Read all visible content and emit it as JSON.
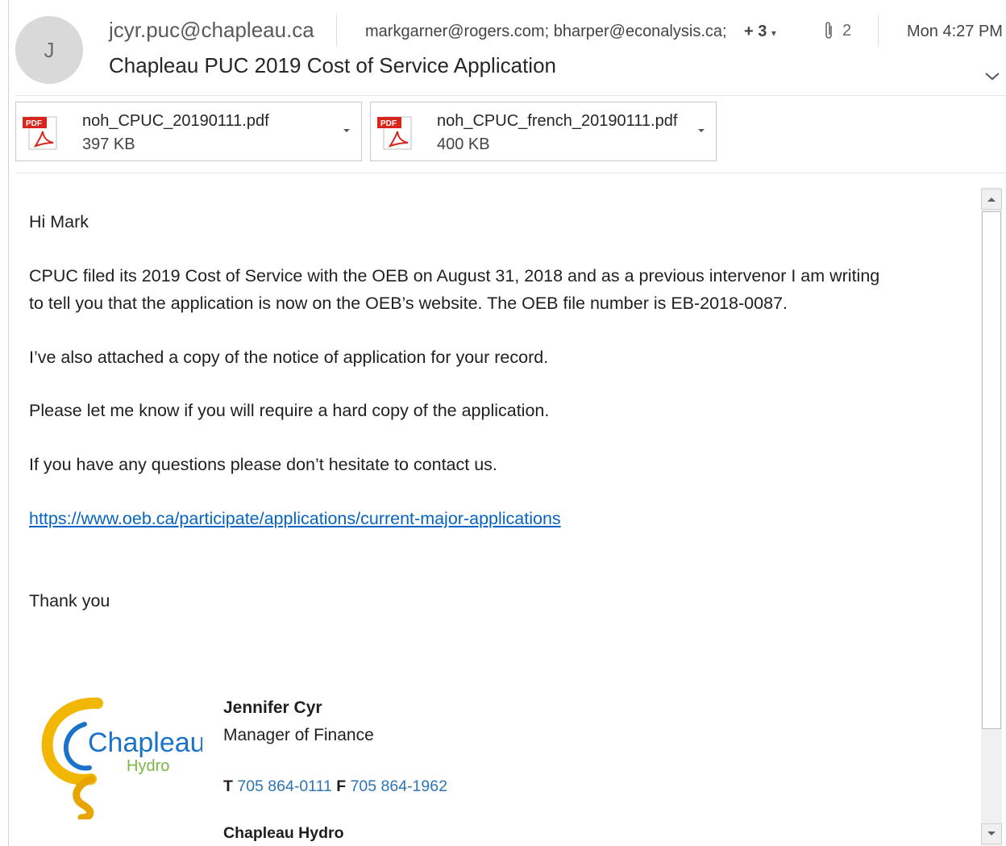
{
  "header": {
    "avatar_initial": "J",
    "from": "jcyr.puc@chapleau.ca",
    "recipients": "markgarner@rogers.com; bharper@econalysis.ca;",
    "more_recipients": "+ 3",
    "attachment_count": "2",
    "time": "Mon 4:27 PM",
    "subject": "Chapleau PUC 2019 Cost of Service Application"
  },
  "attachments": [
    {
      "name": "noh_CPUC_20190111.pdf",
      "size": "397 KB",
      "icon": "pdf-icon"
    },
    {
      "name": "noh_CPUC_french_20190111.pdf",
      "size": "400 KB",
      "icon": "pdf-icon"
    }
  ],
  "body": {
    "greeting": "Hi Mark",
    "para1_line1": "CPUC filed its 2019 Cost of Service with the OEB on August 31, 2018  and as a previous intervenor I am writing",
    "para1_line2": "to tell you that the application is now on the OEB’s website.  The OEB file number is EB-2018-0087.",
    "para2": "I’ve also attached a copy of the notice of application for your record.",
    "para3": "Please let me know if you will require a hard copy of the application.",
    "para4": "If you have any questions please don’t hesitate to contact us.",
    "link": "https://www.oeb.ca/participate/applications/current-major-applications",
    "closing": "Thank you"
  },
  "signature": {
    "name": "Jennifer Cyr",
    "title": "Manager of Finance",
    "tel_label": "T",
    "tel": "705 864-0111",
    "fax_label": "F",
    "fax": "705 864-1962",
    "company": "Chapleau Hydro",
    "logo_text_main": "Chapleau",
    "logo_text_sub": "Hydro"
  },
  "colors": {
    "link": "#0563c1",
    "pdf_red": "#d9261c",
    "logo_yellow": "#f2b705",
    "logo_blue": "#1a73c8",
    "logo_green": "#7ab648"
  }
}
